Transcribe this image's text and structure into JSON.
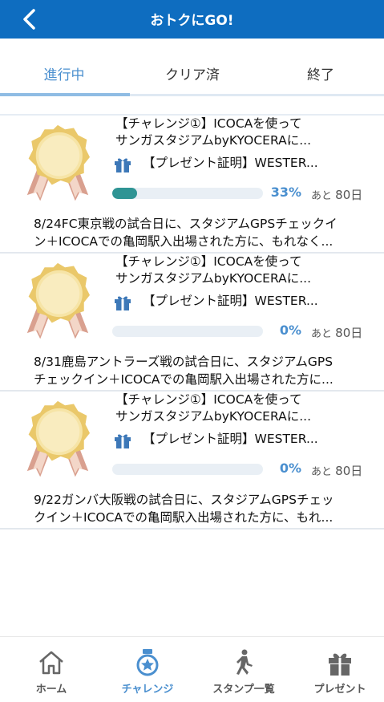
{
  "header": {
    "title": "おトクにGO!",
    "back_icon": "chevron-left-icon"
  },
  "tabs": [
    {
      "label": "進行中",
      "active": true
    },
    {
      "label": "クリア済",
      "active": false
    },
    {
      "label": "終了",
      "active": false
    }
  ],
  "challenges": [
    {
      "title_line1": "【チャレンジ①】ICOCAを使って",
      "title_line2": "サンガスタジアムbyKYOCERAに...",
      "present": "【プレゼント証明】WESTER...",
      "progress_percent": 33,
      "progress_label": "33%",
      "days_prefix": "あと",
      "days_value": "80日",
      "desc_line1": "8/24FC東京戦の試合日に、スタジアムGPSチェックイ",
      "desc_line2": "ン＋ICOCAでの亀岡駅入出場された方に、もれなく..."
    },
    {
      "title_line1": "【チャレンジ①】ICOCAを使って",
      "title_line2": "サンガスタジアムbyKYOCERAに...",
      "present": "【プレゼント証明】WESTER...",
      "progress_percent": 0,
      "progress_label": "0%",
      "days_prefix": "あと",
      "days_value": "80日",
      "desc_line1": "8/31鹿島アントラーズ戦の試合日に、スタジアムGPS",
      "desc_line2": "チェックイン＋ICOCAでの亀岡駅入出場された方に..."
    },
    {
      "title_line1": "【チャレンジ①】ICOCAを使って",
      "title_line2": "サンガスタジアムbyKYOCERAに...",
      "present": "【プレゼント証明】WESTER...",
      "progress_percent": 0,
      "progress_label": "0%",
      "days_prefix": "あと",
      "days_value": "80日",
      "desc_line1": "9/22ガンバ大阪戦の試合日に、スタジアムGPSチェッ",
      "desc_line2": "クイン＋ICOCAでの亀岡駅入出場された方に、もれ..."
    }
  ],
  "bottom_nav": [
    {
      "label": "ホーム",
      "icon": "home-icon",
      "active": false
    },
    {
      "label": "チャレンジ",
      "icon": "medal-icon",
      "active": true
    },
    {
      "label": "スタンプ一覧",
      "icon": "walking-person-icon",
      "active": false
    },
    {
      "label": "プレゼント",
      "icon": "gift-icon",
      "active": false
    }
  ],
  "colors": {
    "header_bg": "#0e6dc0",
    "accent": "#4a8fcf",
    "progress_fill": "#2f9494",
    "progress_track": "#e9eff5",
    "medal_gold": "#f2d98a",
    "medal_ribbon": "#d9a08f"
  }
}
